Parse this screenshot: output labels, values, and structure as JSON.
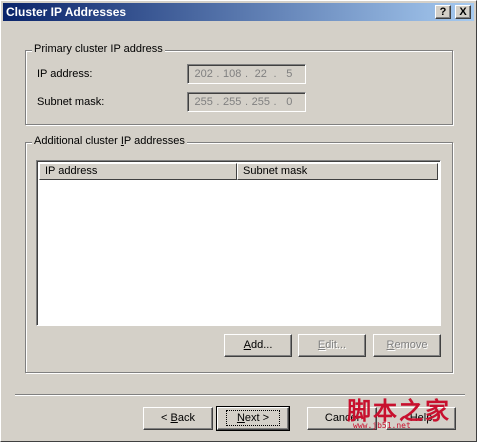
{
  "window": {
    "title": "Cluster IP Addresses",
    "help_glyph": "?",
    "close_glyph": "X"
  },
  "primary": {
    "legend": "Primary cluster IP address",
    "ip_label": "IP address:",
    "ip_octets": [
      "202",
      "108",
      "22",
      "5"
    ],
    "mask_label": "Subnet mask:",
    "mask_octets": [
      "255",
      "255",
      "255",
      "0"
    ]
  },
  "additional": {
    "legend_pre": "Additional cluster ",
    "legend_acc": "I",
    "legend_post": "P addresses",
    "columns": [
      "IP address",
      "Subnet mask"
    ],
    "rows": []
  },
  "buttons": {
    "add": {
      "acc": "A",
      "rest": "dd..."
    },
    "edit": {
      "acc": "E",
      "rest": "dit..."
    },
    "remove": {
      "acc": "R",
      "rest": "emove"
    },
    "back": {
      "pre": "< ",
      "acc": "B",
      "rest": "ack"
    },
    "next": {
      "acc": "N",
      "rest": "ext >"
    },
    "cancel": "Cancel",
    "help": "Help"
  },
  "watermark": {
    "text": "脚本之家",
    "sub": "www.jb51.net"
  }
}
